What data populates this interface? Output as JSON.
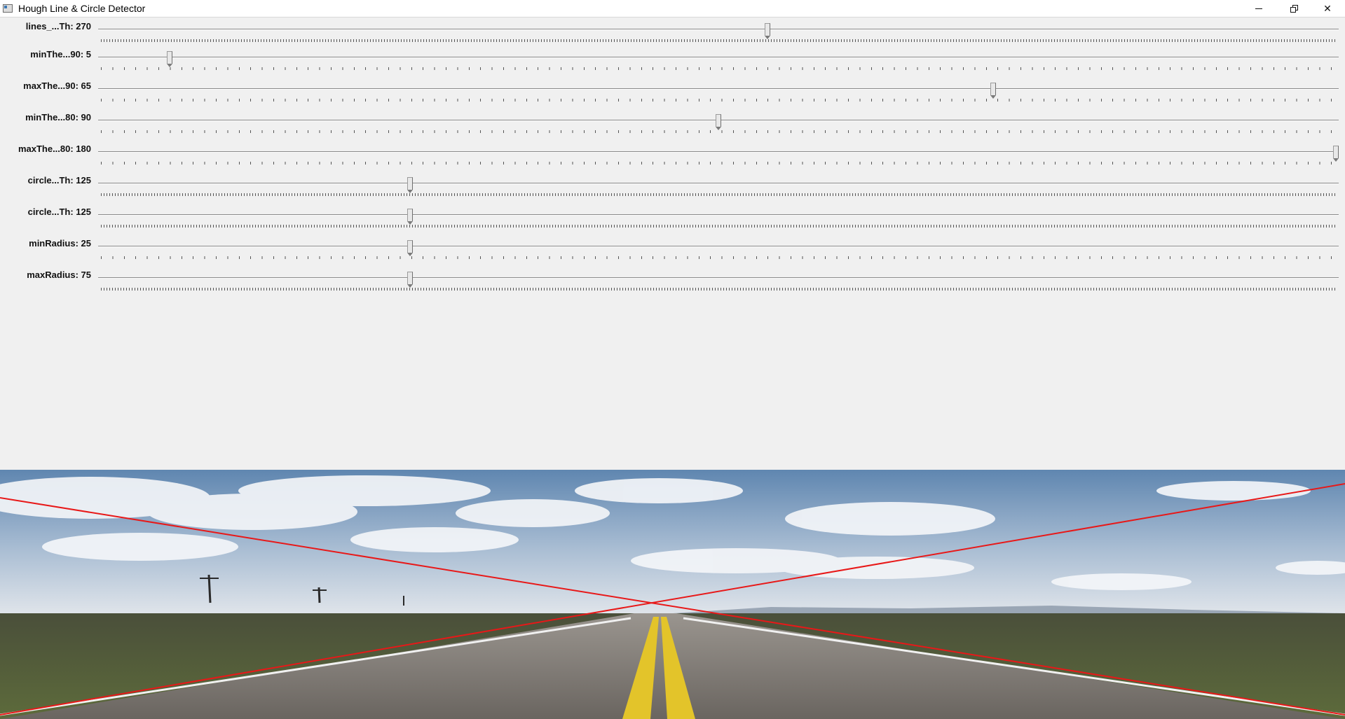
{
  "window": {
    "title": "Hough Line & Circle Detector",
    "minimize_icon": "minimize-icon",
    "maximize_icon": "restore-icon",
    "close_icon": "close-icon",
    "close_label": "✕"
  },
  "sliders": [
    {
      "label": "lines_...Th: 270",
      "value": 270,
      "max": 500,
      "ticks": "dense"
    },
    {
      "label": "minThe...90: 5",
      "value": 5,
      "max": 90,
      "ticks": "sparse"
    },
    {
      "label": "maxThe...90: 65",
      "value": 65,
      "max": 90,
      "ticks": "sparse"
    },
    {
      "label": "minThe...80: 90",
      "value": 90,
      "max": 180,
      "ticks": "sparse"
    },
    {
      "label": "maxThe...80: 180",
      "value": 180,
      "max": 180,
      "ticks": "sparse"
    },
    {
      "label": "circle...Th: 125",
      "value": 125,
      "max": 500,
      "ticks": "dense"
    },
    {
      "label": "circle...Th: 125",
      "value": 125,
      "max": 500,
      "ticks": "dense"
    },
    {
      "label": "minRadius: 25",
      "value": 25,
      "max": 100,
      "ticks": "sparse"
    },
    {
      "label": "maxRadius: 75",
      "value": 75,
      "max": 300,
      "ticks": "dense"
    }
  ],
  "image": {
    "subject": "road-photo",
    "detected_line_color": "#e81818",
    "sky_color": "#6f93b8",
    "road_color": "#6e6a66",
    "lane_color": "#e3c42a"
  }
}
